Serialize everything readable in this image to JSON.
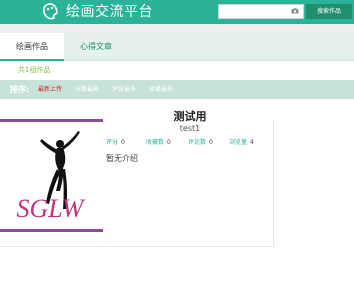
{
  "header": {
    "site_title": "绘画交流平台",
    "logo_icon": "palette-logo-icon",
    "colors": {
      "brand": "#2bb39a",
      "button": "#1f8f6e"
    },
    "search": {
      "value": "",
      "placeholder": ""
    },
    "search_button_label": "搜索作品"
  },
  "tabs": [
    {
      "label": "绘画作品",
      "active": true
    },
    {
      "label": "心得文章",
      "active": false
    }
  ],
  "summary": {
    "count_text": "共1组作品"
  },
  "sort": {
    "label": "排序:",
    "options": [
      {
        "label": "最新上传",
        "active": true
      },
      {
        "label": "分数最高",
        "active": false
      },
      {
        "label": "评论最多",
        "active": false
      },
      {
        "label": "收藏最多",
        "active": false
      }
    ]
  },
  "work": {
    "title": "测试用",
    "author": "test1",
    "image_text": "SGLW",
    "stats": [
      {
        "label": "评分",
        "value": "0"
      },
      {
        "label": "收藏数",
        "value": "0"
      },
      {
        "label": "评论数",
        "value": "0"
      },
      {
        "label": "浏览量",
        "value": "4"
      }
    ],
    "intro": "暂无介绍"
  }
}
